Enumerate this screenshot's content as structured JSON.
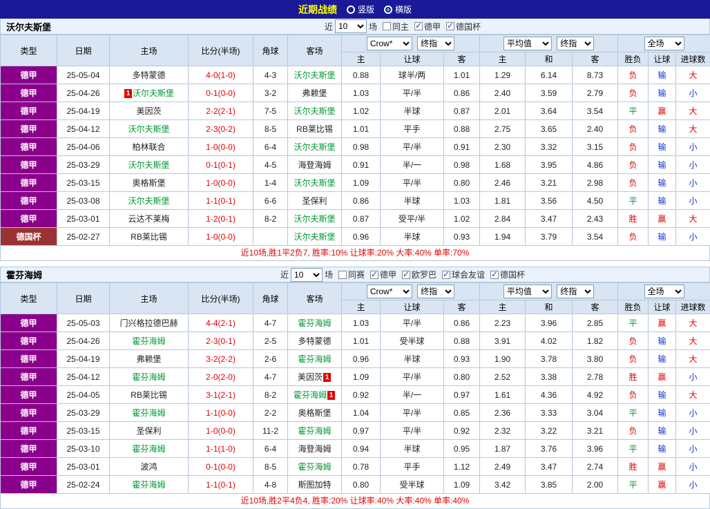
{
  "topbar": {
    "title": "近期战绩",
    "radios": [
      {
        "label": "竖版",
        "checked": false
      },
      {
        "label": "横版",
        "checked": true
      }
    ]
  },
  "labels": {
    "near": "近",
    "count": "10",
    "games": "场"
  },
  "selects": {
    "company": "Crow*",
    "final": "终指",
    "avg": "平均值",
    "scope": "全场"
  },
  "header": {
    "cols": [
      "类型",
      "日期",
      "主场",
      "比分(半场)",
      "角球",
      "客场"
    ],
    "sub": [
      "主",
      "让球",
      "客",
      "主",
      "和",
      "客",
      "胜负",
      "让球",
      "进球数"
    ]
  },
  "league_colors": {
    "德甲": "#8B008B",
    "德国杯": "#993333"
  },
  "colors": {
    "topbar_bg": "#1A1A99",
    "title_yellow": "#FFFF00",
    "team_green": "#009933",
    "win_red": "#E60000",
    "lose_blue": "#1133CC",
    "header_bg": "#D9E5F2",
    "grid_border": "#B4C8DC"
  },
  "sections": [
    {
      "team": "沃尔夫斯堡",
      "filters": [
        {
          "label": "同主",
          "checked": false
        },
        {
          "label": "德甲",
          "checked": true
        },
        {
          "label": "德国杯",
          "checked": true
        }
      ],
      "rows": [
        {
          "league": "德甲",
          "date": "25-05-04",
          "home": "多特蒙德",
          "ht": false,
          "score": "4-0(1-0)",
          "corner": "4-3",
          "away": "沃尔夫斯堡",
          "at": true,
          "a1": "0.88",
          "ah": "球半/两",
          "a2": "1.01",
          "e1": "1.29",
          "e2": "6.14",
          "e3": "8.73",
          "r1": "负",
          "r2": "输",
          "r3": "大"
        },
        {
          "league": "德甲",
          "date": "25-04-26",
          "home": "沃尔夫斯堡",
          "ht": true,
          "hbpre": "1",
          "score": "0-1(0-0)",
          "corner": "3-2",
          "away": "弗赖堡",
          "at": false,
          "a1": "1.03",
          "ah": "平/半",
          "a2": "0.86",
          "e1": "2.40",
          "e2": "3.59",
          "e3": "2.79",
          "r1": "负",
          "r2": "输",
          "r3": "小"
        },
        {
          "league": "德甲",
          "date": "25-04-19",
          "home": "美因茨",
          "ht": false,
          "score": "2-2(2-1)",
          "corner": "7-5",
          "away": "沃尔夫斯堡",
          "at": true,
          "a1": "1.02",
          "ah": "半球",
          "a2": "0.87",
          "e1": "2.01",
          "e2": "3.64",
          "e3": "3.54",
          "r1": "平",
          "r2": "赢",
          "r3": "大"
        },
        {
          "league": "德甲",
          "date": "25-04-12",
          "home": "沃尔夫斯堡",
          "ht": true,
          "score": "2-3(0-2)",
          "corner": "8-5",
          "away": "RB莱比锡",
          "at": false,
          "a1": "1.01",
          "ah": "平手",
          "a2": "0.88",
          "e1": "2.75",
          "e2": "3.65",
          "e3": "2.40",
          "r1": "负",
          "r2": "输",
          "r3": "大"
        },
        {
          "league": "德甲",
          "date": "25-04-06",
          "home": "柏林联合",
          "ht": false,
          "score": "1-0(0-0)",
          "corner": "6-4",
          "away": "沃尔夫斯堡",
          "at": true,
          "a1": "0.98",
          "ah": "平/半",
          "a2": "0.91",
          "e1": "2.30",
          "e2": "3.32",
          "e3": "3.15",
          "r1": "负",
          "r2": "输",
          "r3": "小"
        },
        {
          "league": "德甲",
          "date": "25-03-29",
          "home": "沃尔夫斯堡",
          "ht": true,
          "score": "0-1(0-1)",
          "corner": "4-5",
          "away": "海登海姆",
          "at": false,
          "a1": "0.91",
          "ah": "半/一",
          "a2": "0.98",
          "e1": "1.68",
          "e2": "3.95",
          "e3": "4.86",
          "r1": "负",
          "r2": "输",
          "r3": "小"
        },
        {
          "league": "德甲",
          "date": "25-03-15",
          "home": "奥格斯堡",
          "ht": false,
          "score": "1-0(0-0)",
          "corner": "1-4",
          "away": "沃尔夫斯堡",
          "at": true,
          "a1": "1.09",
          "ah": "平/半",
          "a2": "0.80",
          "e1": "2.46",
          "e2": "3.21",
          "e3": "2.98",
          "r1": "负",
          "r2": "输",
          "r3": "小"
        },
        {
          "league": "德甲",
          "date": "25-03-08",
          "home": "沃尔夫斯堡",
          "ht": true,
          "score": "1-1(0-1)",
          "corner": "6-6",
          "away": "圣保利",
          "at": false,
          "a1": "0.86",
          "ah": "半球",
          "a2": "1.03",
          "e1": "1.81",
          "e2": "3.56",
          "e3": "4.50",
          "r1": "平",
          "r2": "输",
          "r3": "小"
        },
        {
          "league": "德甲",
          "date": "25-03-01",
          "home": "云达不莱梅",
          "ht": false,
          "score": "1-2(0-1)",
          "corner": "8-2",
          "away": "沃尔夫斯堡",
          "at": true,
          "a1": "0.87",
          "ah": "受平/半",
          "a2": "1.02",
          "e1": "2.84",
          "e2": "3.47",
          "e3": "2.43",
          "r1": "胜",
          "r2": "赢",
          "r3": "大"
        },
        {
          "league": "德国杯",
          "date": "25-02-27",
          "home": "RB莱比锡",
          "ht": false,
          "score": "1-0(0-0)",
          "corner": "",
          "away": "沃尔夫斯堡",
          "at": true,
          "a1": "0.96",
          "ah": "半球",
          "a2": "0.93",
          "e1": "1.94",
          "e2": "3.79",
          "e3": "3.54",
          "r1": "负",
          "r2": "输",
          "r3": "小"
        }
      ],
      "summary": "近10场,胜1平2负7, 胜率:10% 让球率:20% 大率:40% 单率:70%"
    },
    {
      "team": "霍芬海姆",
      "filters": [
        {
          "label": "同赛",
          "checked": false
        },
        {
          "label": "德甲",
          "checked": true
        },
        {
          "label": "欧罗巴",
          "checked": true
        },
        {
          "label": "球会友谊",
          "checked": true
        },
        {
          "label": "德国杯",
          "checked": true
        }
      ],
      "rows": [
        {
          "league": "德甲",
          "date": "25-05-03",
          "home": "门兴格拉德巴赫",
          "ht": false,
          "score": "4-4(2-1)",
          "corner": "4-7",
          "away": "霍芬海姆",
          "at": true,
          "a1": "1.03",
          "ah": "平/半",
          "a2": "0.86",
          "e1": "2.23",
          "e2": "3.96",
          "e3": "2.85",
          "r1": "平",
          "r2": "赢",
          "r3": "大"
        },
        {
          "league": "德甲",
          "date": "25-04-26",
          "home": "霍芬海姆",
          "ht": true,
          "score": "2-3(0-1)",
          "corner": "2-5",
          "away": "多特蒙德",
          "at": false,
          "a1": "1.01",
          "ah": "受半球",
          "a2": "0.88",
          "e1": "3.91",
          "e2": "4.02",
          "e3": "1.82",
          "r1": "负",
          "r2": "输",
          "r3": "大"
        },
        {
          "league": "德甲",
          "date": "25-04-19",
          "home": "弗赖堡",
          "ht": false,
          "score": "3-2(2-2)",
          "corner": "2-6",
          "away": "霍芬海姆",
          "at": true,
          "a1": "0.96",
          "ah": "半球",
          "a2": "0.93",
          "e1": "1.90",
          "e2": "3.78",
          "e3": "3.80",
          "r1": "负",
          "r2": "输",
          "r3": "大"
        },
        {
          "league": "德甲",
          "date": "25-04-12",
          "home": "霍芬海姆",
          "ht": true,
          "score": "2-0(2-0)",
          "corner": "4-7",
          "away": "美因茨",
          "at": false,
          "abpost": "1",
          "a1": "1.09",
          "ah": "平/半",
          "a2": "0.80",
          "e1": "2.52",
          "e2": "3.38",
          "e3": "2.78",
          "r1": "胜",
          "r2": "赢",
          "r3": "小"
        },
        {
          "league": "德甲",
          "date": "25-04-05",
          "home": "RB莱比锡",
          "ht": false,
          "score": "3-1(2-1)",
          "corner": "8-2",
          "away": "霍芬海姆",
          "at": true,
          "abpost": "1",
          "a1": "0.92",
          "ah": "半/一",
          "a2": "0.97",
          "e1": "1.61",
          "e2": "4.36",
          "e3": "4.92",
          "r1": "负",
          "r2": "输",
          "r3": "大"
        },
        {
          "league": "德甲",
          "date": "25-03-29",
          "home": "霍芬海姆",
          "ht": true,
          "score": "1-1(0-0)",
          "corner": "2-2",
          "away": "奥格斯堡",
          "at": false,
          "a1": "1.04",
          "ah": "平/半",
          "a2": "0.85",
          "e1": "2.36",
          "e2": "3.33",
          "e3": "3.04",
          "r1": "平",
          "r2": "输",
          "r3": "小"
        },
        {
          "league": "德甲",
          "date": "25-03-15",
          "home": "圣保利",
          "ht": false,
          "score": "1-0(0-0)",
          "corner": "11-2",
          "away": "霍芬海姆",
          "at": true,
          "a1": "0.97",
          "ah": "平/半",
          "a2": "0.92",
          "e1": "2.32",
          "e2": "3.22",
          "e3": "3.21",
          "r1": "负",
          "r2": "输",
          "r3": "小"
        },
        {
          "league": "德甲",
          "date": "25-03-10",
          "home": "霍芬海姆",
          "ht": true,
          "score": "1-1(1-0)",
          "corner": "6-4",
          "away": "海登海姆",
          "at": false,
          "a1": "0.94",
          "ah": "半球",
          "a2": "0.95",
          "e1": "1.87",
          "e2": "3.76",
          "e3": "3.96",
          "r1": "平",
          "r2": "输",
          "r3": "小"
        },
        {
          "league": "德甲",
          "date": "25-03-01",
          "home": "波鸿",
          "ht": false,
          "score": "0-1(0-0)",
          "corner": "8-5",
          "away": "霍芬海姆",
          "at": true,
          "a1": "0.78",
          "ah": "平手",
          "a2": "1.12",
          "e1": "2.49",
          "e2": "3.47",
          "e3": "2.74",
          "r1": "胜",
          "r2": "赢",
          "r3": "小"
        },
        {
          "league": "德甲",
          "date": "25-02-24",
          "home": "霍芬海姆",
          "ht": true,
          "score": "1-1(0-1)",
          "corner": "4-8",
          "away": "斯图加特",
          "at": false,
          "a1": "0.80",
          "ah": "受半球",
          "a2": "1.09",
          "e1": "3.42",
          "e2": "3.85",
          "e3": "2.00",
          "r1": "平",
          "r2": "赢",
          "r3": "小"
        }
      ],
      "summary": "近10场,胜2平4负4, 胜率:20% 让球率:40% 大率:40% 单率:40%"
    }
  ]
}
